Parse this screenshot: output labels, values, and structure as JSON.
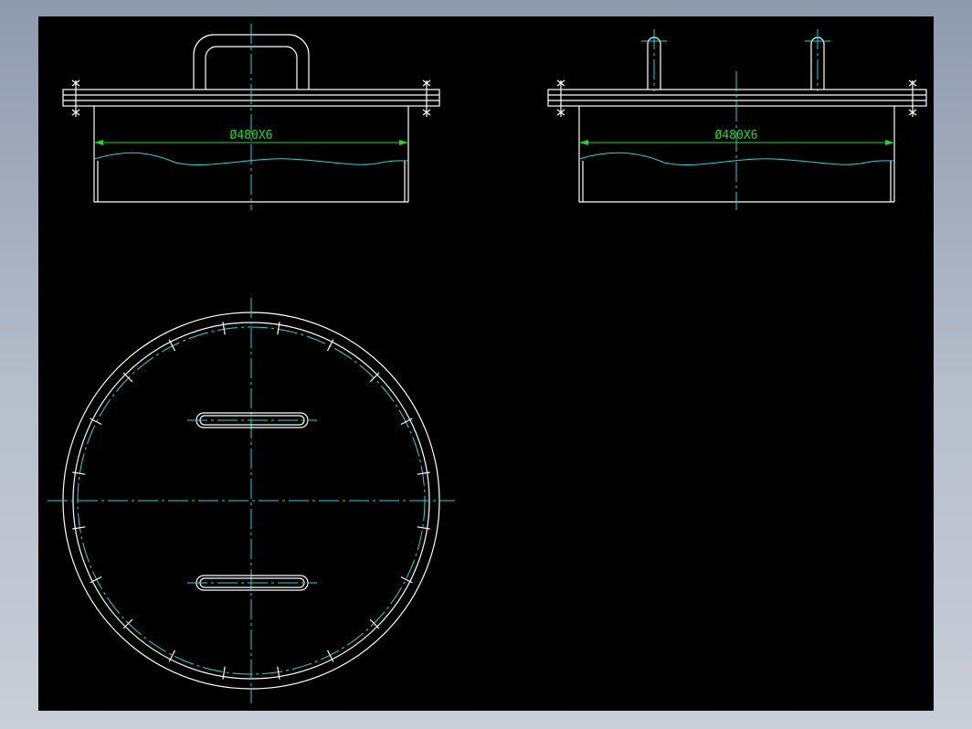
{
  "drawing": {
    "background_color": "#000000",
    "outline_color": "#ffffff",
    "centerline_color": "#1fd8d8",
    "dimension_color": "#22d822",
    "views": [
      {
        "id": "front-view-handle",
        "dimension_label": "Ø480X6"
      },
      {
        "id": "front-view-lugs",
        "dimension_label": "Ø480X6"
      },
      {
        "id": "plan-view",
        "dimension_label": ""
      }
    ]
  }
}
